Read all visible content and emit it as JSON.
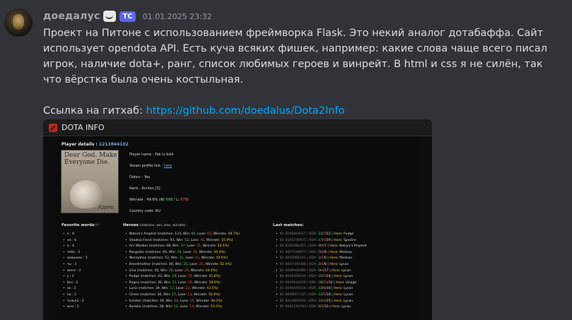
{
  "message": {
    "username": "доедалус",
    "tag": "TC",
    "timestamp": "01.01.2025 23:32",
    "text": "Проект на Питоне с использованием фреймворка Flask. Это некий аналог дотабаффа. Сайт использует opendota API. Есть куча всяких фишек, например: какие слова чаще всего писал игрок, наличие dota+, ранг, список любимых героев и винрейт. В html и css я не силён, так что вёрстка была очень костыльная.",
    "link_prefix": "Ссылка на гитхаб: ",
    "link_text": "https://github.com/doedalus/Dota2Info"
  },
  "screenshot": {
    "nav_title": "DOTA INFO",
    "player_details_label": "Player details : ",
    "player_id": "1213844102",
    "image_text": "Dear God, Make Everyone Die.",
    "image_amen": "Amen.",
    "player_name": "Player name : Fak iu bish",
    "steam_label": "Steam profile link : ",
    "steam_link": "here",
    "dota_plus": "Dota+ : Yes",
    "rank": "Rank : Archon [3]",
    "winrate_prefix": "Winrate : 49.6% (W: ",
    "winrate_w": "668",
    "winrate_sep": " / L: ",
    "winrate_l": "678",
    "winrate_suffix": ")",
    "country": "Country code: RU",
    "words_title": "Favorite words",
    "words_sup": "(*) :",
    "heroes_title": "Heroes",
    "heroes_sub": " (matches, win, lose, winrate) :",
    "matches_title": "Last matches:",
    "words": [
      "я : 6",
      "не : 6",
      "а : 4",
      "тебя : 3",
      "девушки : 3",
      "ты : 3",
      "меня : 3",
      "у : 2",
      "без : 2",
      "за : 2",
      "на : 2",
      "только : 2",
      "мне : 2"
    ],
    "heroes": [
      {
        "name": "Nature's Prophet",
        "m": "123",
        "w": "60",
        "l": "63",
        "wr": "48.7%"
      },
      {
        "name": "Shadow Fiend",
        "m": "93",
        "w": "52",
        "l": "41",
        "wr": "55.9%"
      },
      {
        "name": "Arc Warden",
        "m": "68",
        "w": "37",
        "l": "31",
        "wr": "54.4%"
      },
      {
        "name": "Pangolier",
        "m": "60",
        "w": "30",
        "l": "30",
        "wr": "50.0%"
      },
      {
        "name": "Necrophos",
        "m": "52",
        "w": "31",
        "l": "21",
        "wr": "59.6%"
      },
      {
        "name": "Broodmother",
        "m": "48",
        "w": "25",
        "l": "23",
        "wr": "52.0%"
      },
      {
        "name": "Lina",
        "m": "45",
        "w": "20",
        "l": "25",
        "wr": "44.4%"
      },
      {
        "name": "Pudge",
        "m": "43",
        "w": "18",
        "l": "25",
        "wr": "41.8%"
      },
      {
        "name": "Pugna",
        "m": "39",
        "w": "23",
        "l": "16",
        "wr": "58.9%"
      },
      {
        "name": "Luna",
        "m": "39",
        "w": "17",
        "l": "22",
        "wr": "43.5%"
      },
      {
        "name": "Clinkz",
        "m": "30",
        "w": "17",
        "l": "13",
        "wr": "56.6%"
      },
      {
        "name": "Invoker",
        "m": "29",
        "w": "14",
        "l": "15",
        "wr": "48.2%"
      },
      {
        "name": "Kunkka",
        "m": "28",
        "w": "15",
        "l": "13",
        "wr": "53.5%"
      }
    ],
    "matches": [
      {
        "id": "8105816627",
        "k": "23",
        "d": "7",
        "a": "22",
        "hero": "Pudge"
      },
      {
        "id": "8105749975",
        "k": "17",
        "d": "7",
        "a": "29",
        "hero": "Spectre"
      },
      {
        "id": "8105680451",
        "k": "9",
        "d": "9",
        "a": "7",
        "hero": "Nature's Prophet"
      },
      {
        "id": "8057539877",
        "k": "5",
        "d": "6",
        "a": "8",
        "hero": "Medusa"
      },
      {
        "id": "8054968101",
        "k": "1",
        "d": "1",
        "a": "6",
        "hero": "Medusa"
      },
      {
        "id": "8047340486",
        "k": "2",
        "d": "3",
        "a": "8",
        "hero": "Lycan"
      },
      {
        "id": "8046940480",
        "k": "0",
        "d": "4",
        "a": "17",
        "hero": "Lycan"
      },
      {
        "id": "8046450144",
        "k": "10",
        "d": "7",
        "a": "24",
        "hero": "Lycan"
      },
      {
        "id": "8045644436",
        "k": "18",
        "d": "10",
        "a": "32",
        "hero": "Visage"
      },
      {
        "id": "8045440334",
        "k": "23",
        "d": "8",
        "a": "10",
        "hero": "Lycan"
      },
      {
        "id": "8044057337",
        "k": "12",
        "d": "7",
        "a": "18",
        "hero": "Lycan"
      },
      {
        "id": "8042850592",
        "k": "14",
        "d": "3",
        "a": "25",
        "hero": "Lycan"
      },
      {
        "id": "8041194783",
        "k": "8",
        "d": "5",
        "a": "33",
        "hero": "Lycan"
      }
    ]
  }
}
